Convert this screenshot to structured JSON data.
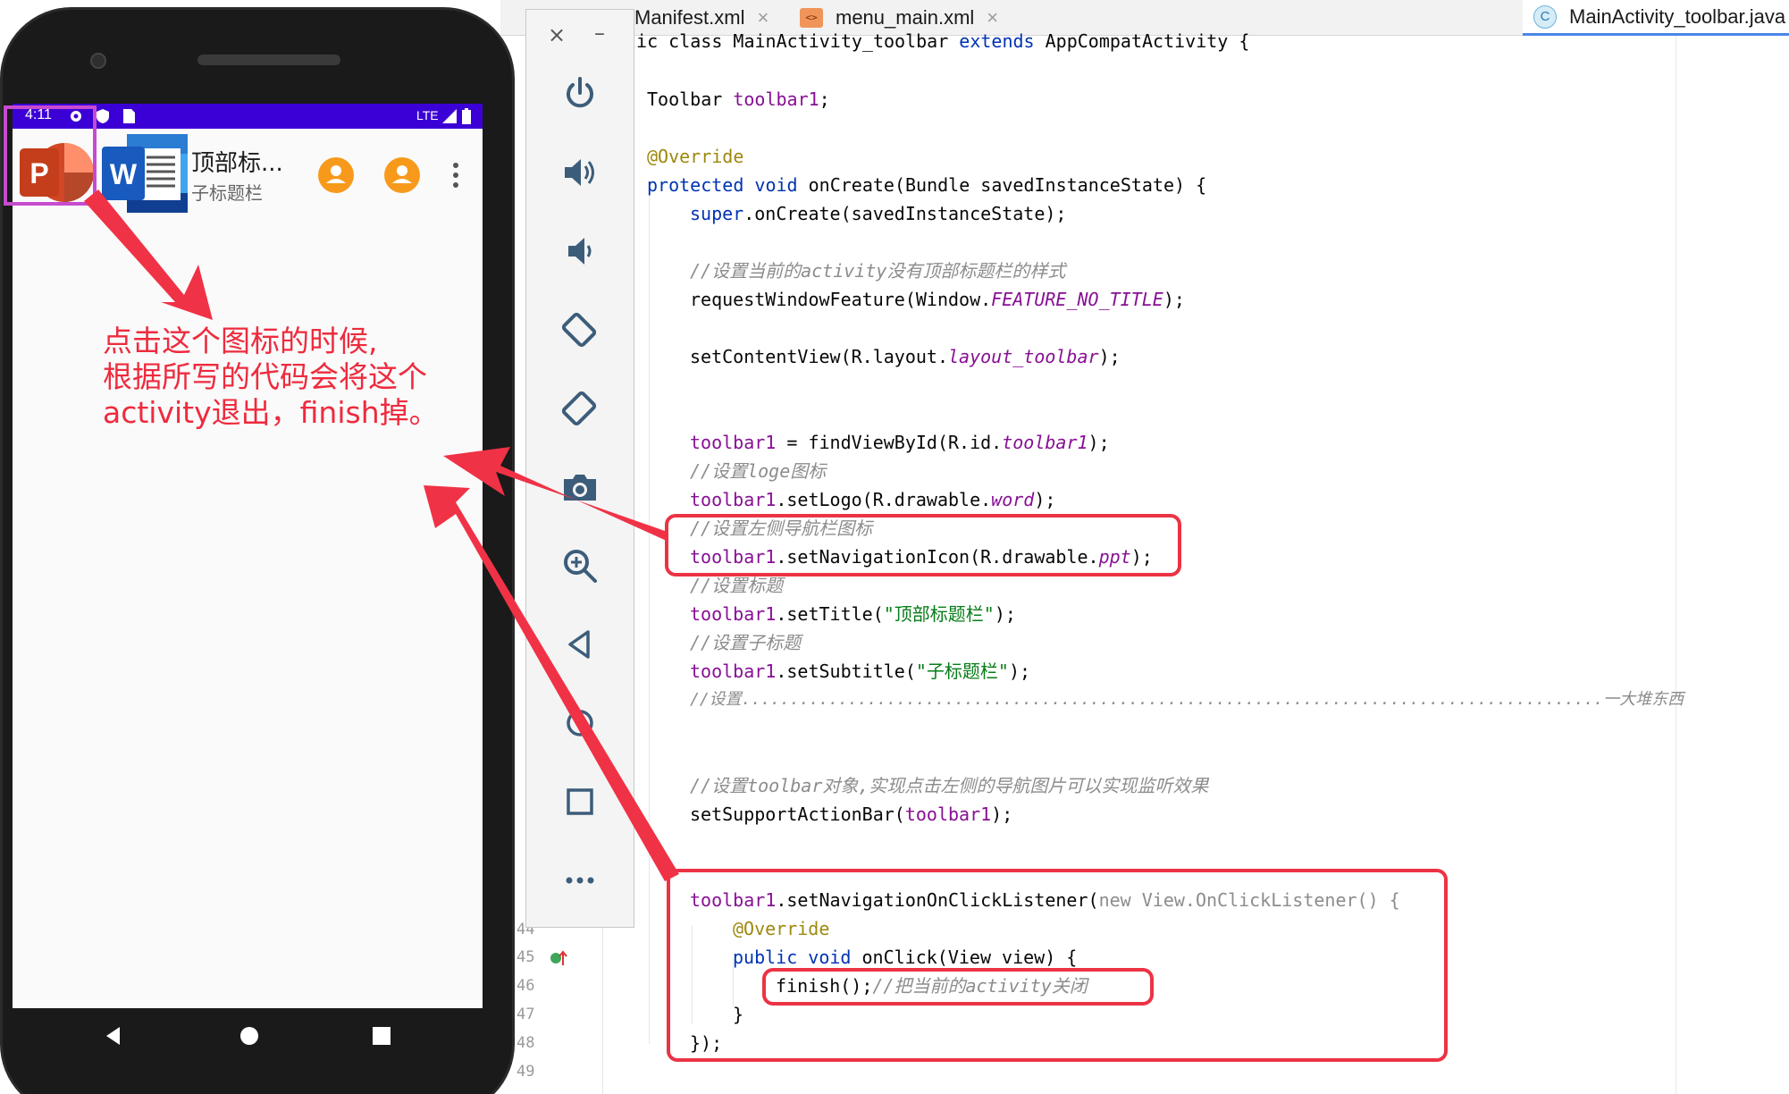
{
  "ide": {
    "tabs": [
      {
        "label": "Manifest.xml",
        "close": "×"
      },
      {
        "label": "menu_main.xml",
        "close": "×"
      },
      {
        "label": "MainActivity_toolbar.java",
        "close": "×"
      }
    ],
    "java_icon_letter": "C",
    "xml_icon_glyph": "<>",
    "line_numbers": [
      "44",
      "45",
      "46",
      "47",
      "48",
      "49"
    ],
    "code": {
      "l1_a": "lic class MainActivity_toolbar ",
      "l1_kw": "extends",
      "l1_b": " AppCompatActivity {",
      "l2_a": "Toolbar ",
      "l2_fld": "toolbar1",
      "l2_b": ";",
      "l3": "@Override",
      "l4_kw": "protected void ",
      "l4_b": "onCreate(Bundle savedInstanceState) {",
      "l5_kw": "super",
      "l5_b": ".onCreate(savedInstanceState);",
      "l6": "//设置当前的activity没有顶部标题栏的样式",
      "l7_a": "requestWindowFeature(Window.",
      "l7_fld": "FEATURE_NO_TITLE",
      "l7_b": ");",
      "l8_a": "setContentView(R.layout.",
      "l8_fld": "layout_toolbar",
      "l8_b": ");",
      "l9_fld": "toolbar1",
      "l9_a": " = findViewById(R.id.",
      "l9_fld2": "toolbar1",
      "l9_b": ");",
      "l10": "//设置loge图标",
      "l11_fld": "toolbar1",
      "l11_a": ".setLogo(R.drawable.",
      "l11_fld2": "word",
      "l11_b": ");",
      "l12": "//设置左侧导航栏图标",
      "l13_fld": "toolbar1",
      "l13_a": ".setNavigationIcon(R.drawable.",
      "l13_fld2": "ppt",
      "l13_b": ");",
      "l14": "//设置标题",
      "l15_fld": "toolbar1",
      "l15_a": ".setTitle(",
      "l15_str": "\"顶部标题栏\"",
      "l15_b": ");",
      "l16": "//设置子标题",
      "l17_fld": "toolbar1",
      "l17_a": ".setSubtitle(",
      "l17_str": "\"子标题栏\"",
      "l17_b": ");",
      "l18": "//设置.........................................................................................一大堆东西",
      "l19": "//设置toolbar对象,实现点击左侧的导航图片可以实现监听效果",
      "l20_a": "setSupportActionBar(",
      "l20_fld": "toolbar1",
      "l20_b": ");",
      "l21_fld": "toolbar1",
      "l21_a": ".setNavigationOnClickListener(",
      "l21_kw": "new ",
      "l21_b": "View.OnClickListener() {",
      "l22": "@Override",
      "l23_kw": "public void ",
      "l23_b": "onClick(View view) {",
      "l24_a": "finish();",
      "l24_cmt": "//把当前的activity关闭",
      "l25": "}",
      "l26": "});"
    }
  },
  "phone": {
    "status_time": "4:11",
    "status_network": "LTE",
    "toolbar_title": "顶部标...",
    "toolbar_subtitle": "子标题栏",
    "ppt_letter": "P",
    "word_letter": "W"
  },
  "annotation": {
    "line1": "点击这个图标的时候,",
    "line2": "根据所写的代码会将这个",
    "line3": "activity退出，finish掉。",
    "color": "#ee2b3e"
  },
  "emulator_toolbar": {
    "close": "×",
    "minimize": "–",
    "buttons": [
      "power-icon",
      "volume-up-icon",
      "volume-down-icon",
      "rotate-left-icon",
      "rotate-right-icon",
      "camera-icon",
      "zoom-icon",
      "back-icon",
      "home-icon",
      "overview-icon",
      "more-icon"
    ]
  }
}
